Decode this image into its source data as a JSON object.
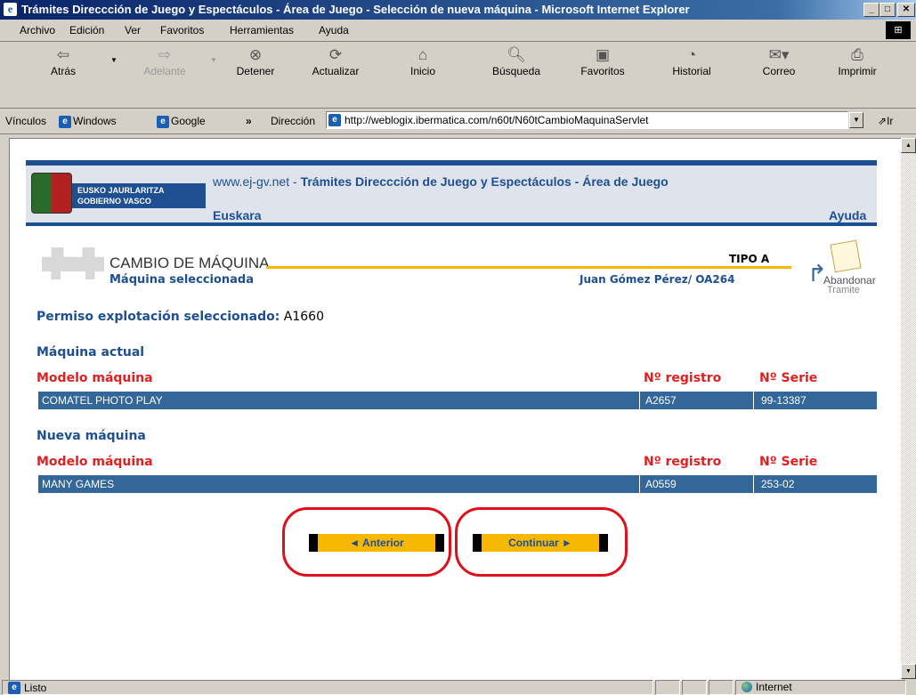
{
  "window": {
    "title": "Trámites Direccción de Juego y Espectáculos - Área de Juego - Selección de nueva máquina - Microsoft Internet Explorer"
  },
  "menu": [
    "Archivo",
    "Edición",
    "Ver",
    "Favoritos",
    "Herramientas",
    "Ayuda"
  ],
  "toolbar": {
    "back": "Atrás",
    "forward": "Adelante",
    "stop": "Detener",
    "refresh": "Actualizar",
    "home": "Inicio",
    "search": "Búsqueda",
    "favorites": "Favoritos",
    "history": "Historial",
    "mail": "Correo",
    "print": "Imprimir"
  },
  "links_bar": {
    "label": "Vínculos",
    "items": [
      "Windows",
      "Google"
    ],
    "chevron": "»"
  },
  "address": {
    "label": "Dirección",
    "url": "http://weblogix.ibermatica.com/n60t/N60tCambioMaquinaServlet",
    "go": "Ir"
  },
  "header": {
    "site": "www.ej-gv.net",
    "separator": "-",
    "section": "Trámites Direccción de Juego y Espectáculos - Área de Juego",
    "lang_link": "Euskara",
    "help_link": "Ayuda",
    "gov_line1": "EUSKO JAURLARITZA",
    "gov_line2": "GOBIERNO VASCO"
  },
  "page": {
    "title": "CAMBIO DE MÁQUINA",
    "subtitle": "Máquina seleccionada",
    "type": "TIPO A",
    "user": "Juan Gómez Pérez/ OA264",
    "abandon_line1": "Abandonar",
    "abandon_line2": "Tramite",
    "permit_label": "Permiso explotación seleccionado:",
    "permit_value": "A1660"
  },
  "current_machine": {
    "heading": "Máquina actual",
    "col_model": "Modelo máquina",
    "col_registry": "Nº registro",
    "col_serial": "Nº Serie",
    "model": "COMATEL PHOTO PLAY",
    "registry": "A2657",
    "serial": "99-13387"
  },
  "new_machine": {
    "heading": "Nueva máquina",
    "col_model": "Modelo máquina",
    "col_registry": "Nº registro",
    "col_serial": "Nº Serie",
    "model": "MANY GAMES",
    "registry": "A0559",
    "serial": "253-02"
  },
  "buttons": {
    "previous": "◄ Anterior",
    "continue": "Continuar ►"
  },
  "status": {
    "text": "Listo",
    "zone": "Internet"
  }
}
